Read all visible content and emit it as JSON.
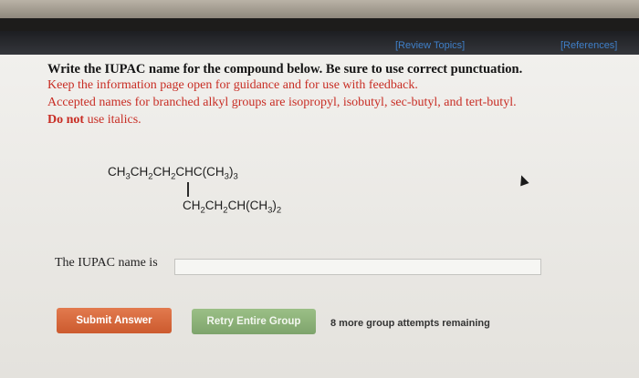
{
  "header": {
    "review_topics": "[Review Topics]",
    "references": "[References]"
  },
  "instructions": {
    "line1": "Write the IUPAC name for the compound below. Be sure to use correct punctuation.",
    "line2": "Keep the information page open for guidance and for use with feedback.",
    "line3": "Accepted names for branched alkyl groups are isopropyl, isobutyl, sec-butyl, and tert-butyl.",
    "line4_bold": "Do not",
    "line4_rest": " use italics."
  },
  "compound": {
    "main_chain": [
      "CH",
      "3",
      "CH",
      "2",
      "CH",
      "2",
      "CHC(CH",
      "3",
      ")",
      "3",
      ""
    ],
    "branch": [
      "CH",
      "2",
      "CH",
      "2",
      "CH(CH",
      "3",
      ")",
      "2",
      ""
    ]
  },
  "answer": {
    "label": "The IUPAC name is",
    "value": "",
    "placeholder": ""
  },
  "buttons": {
    "submit": "Submit Answer",
    "retry": "Retry Entire Group"
  },
  "status": {
    "attempts": "8 more group attempts remaining"
  },
  "colors": {
    "instruction_red": "#c82d24",
    "link_blue": "#3f7fc8",
    "submit_orange": "#cc5a2e",
    "retry_green": "#7ea46c"
  }
}
